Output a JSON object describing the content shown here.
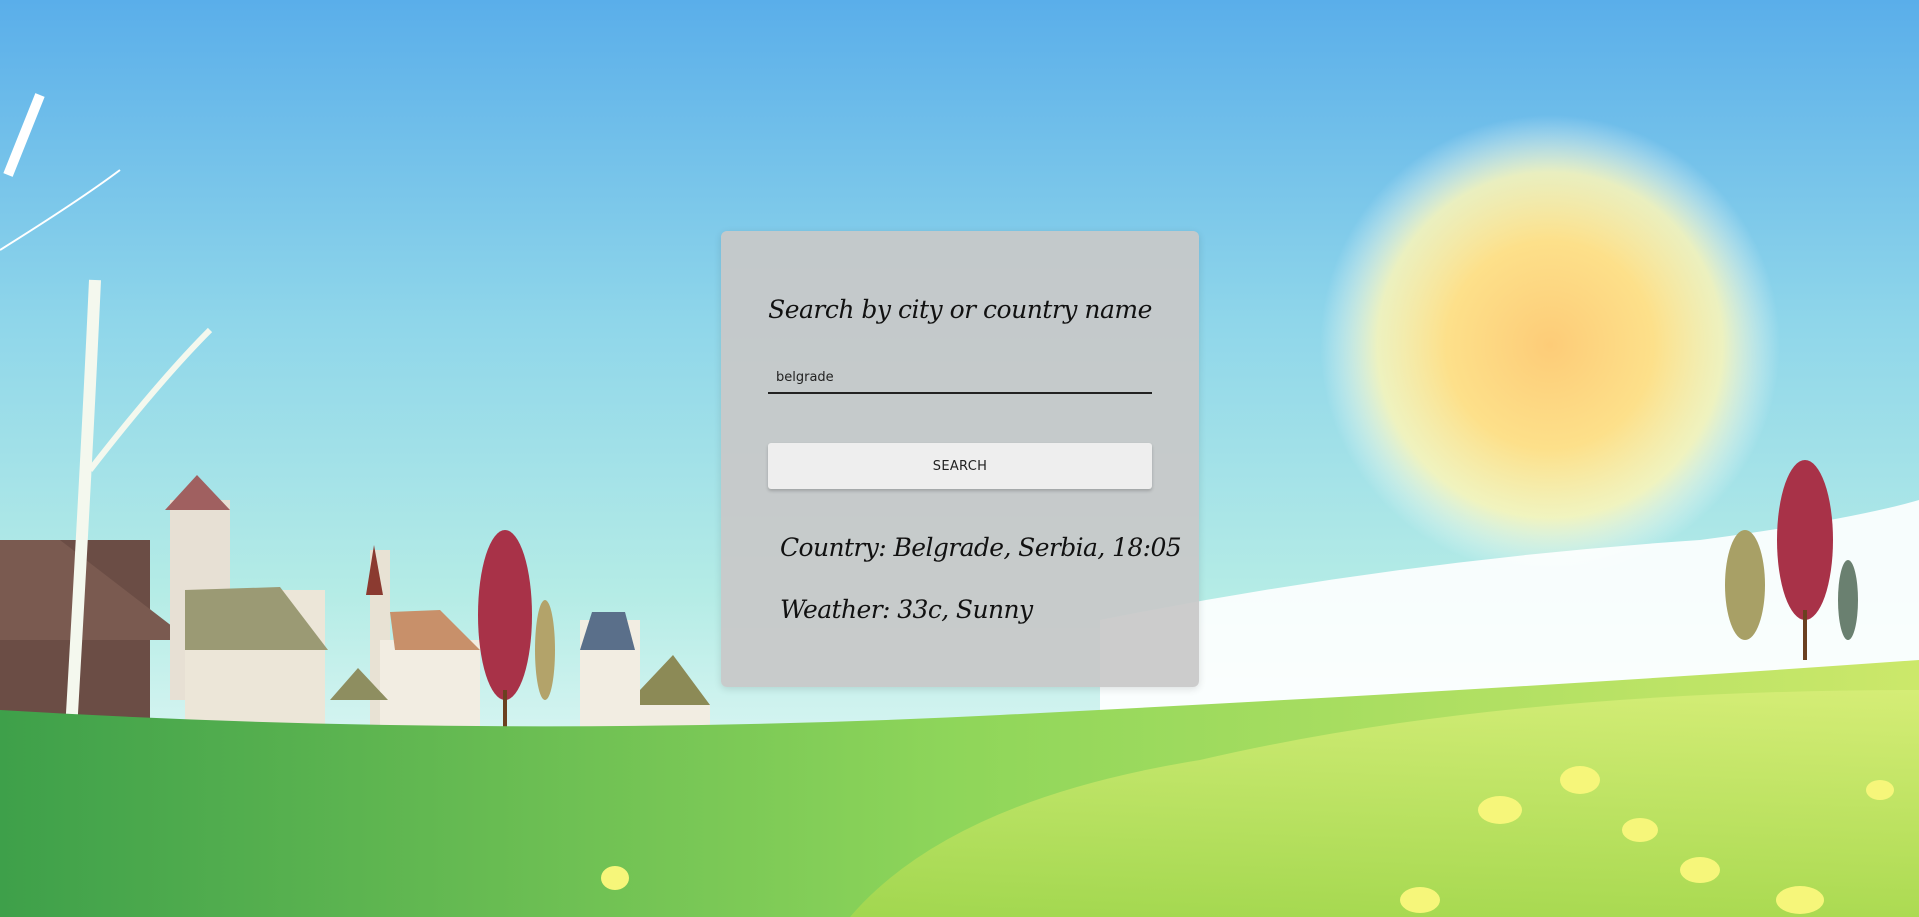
{
  "search_card": {
    "heading": "Search by city or country name",
    "input_value": "belgrade",
    "button_label": "SEARCH",
    "country_line": "Country: Belgrade, Serbia, 18:05",
    "weather_line": "Weather: 33c, Sunny"
  },
  "colors": {
    "sky_top": "#4a9fe0",
    "sky_horizon": "#a8e6e6",
    "sun": "#fdd27a",
    "grass": "#7cc552",
    "card_bg": "#c8c8c8"
  }
}
